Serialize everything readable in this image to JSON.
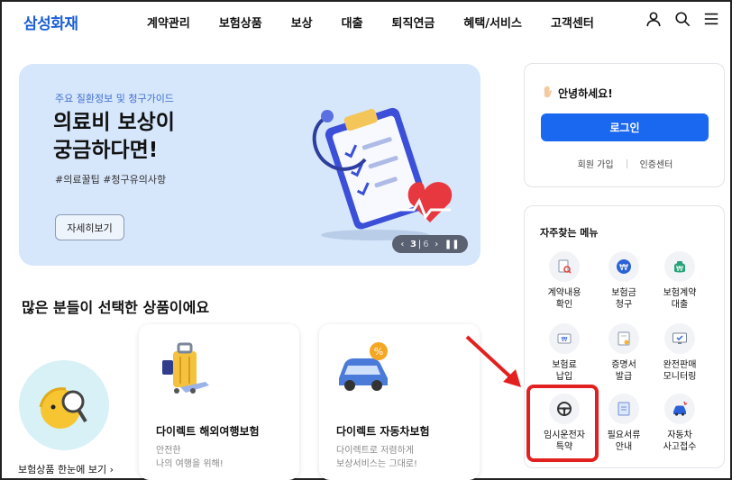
{
  "header": {
    "logo": "삼성화재",
    "nav": [
      "계약관리",
      "보험상품",
      "보상",
      "대출",
      "퇴직연금",
      "혜택/서비스",
      "고객센터"
    ],
    "icons": [
      "user-icon",
      "search-icon",
      "menu-icon"
    ]
  },
  "hero": {
    "eyebrow": "주요 질환정보 및 청구가이드",
    "title": "의료비 보상이\n궁금하다면!",
    "tags": "#의료꿀팁 #청구유의사항",
    "button": "자세히보기",
    "pager": {
      "current": "3",
      "total": "6"
    },
    "background": "#d6e6fb"
  },
  "products": {
    "title": "많은 분들이 선택한 상품이에요",
    "link": "보험상품 한눈에 보기 ›",
    "cards": [
      {
        "title": "다이렉트 해외여행보험",
        "desc": "안전한\n나의 여행을 위해!"
      },
      {
        "title": "다이렉트 자동차보험",
        "desc": "다이렉트로 저렴하게\n보상서비스는 그대로!"
      }
    ]
  },
  "login": {
    "greeting": "안녕하세요!",
    "button": "로그인",
    "links": [
      "회원 가입",
      "인증센터"
    ],
    "accent": "#1a67f0"
  },
  "quick_menu": {
    "title": "자주찾는 메뉴",
    "items": [
      {
        "label": "계약내용\n확인",
        "icon": "contract-search-icon"
      },
      {
        "label": "보험금\n청구",
        "icon": "won-claim-icon"
      },
      {
        "label": "보험계약\n대출",
        "icon": "loan-icon"
      },
      {
        "label": "보험료\n납입",
        "icon": "premium-payment-icon"
      },
      {
        "label": "증명서\n발급",
        "icon": "certificate-icon"
      },
      {
        "label": "완전판매\n모니터링",
        "icon": "monitor-icon"
      },
      {
        "label": "임시운전자\n특약",
        "icon": "steering-wheel-icon"
      },
      {
        "label": "필요서류\n안내",
        "icon": "document-icon"
      },
      {
        "label": "자동차\n사고접수",
        "icon": "car-accident-icon"
      }
    ],
    "highlight_color": "#e32020"
  }
}
